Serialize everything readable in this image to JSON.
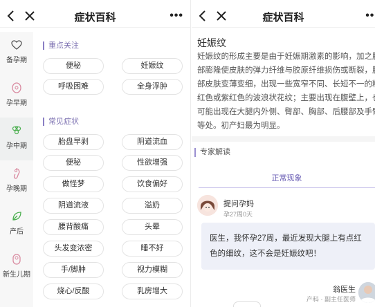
{
  "left": {
    "nav": {
      "title": "症状百科",
      "more": "•••"
    },
    "sidebar": [
      {
        "label": "备孕期",
        "icon": "heart-icon"
      },
      {
        "label": "孕早期",
        "icon": "embryo-icon"
      },
      {
        "label": "孕中期",
        "icon": "grapes-icon",
        "active": true
      },
      {
        "label": "孕晚期",
        "icon": "fetus-icon"
      },
      {
        "label": "产后",
        "icon": "leaf-icon"
      },
      {
        "label": "新生儿期",
        "icon": "baby-icon"
      }
    ],
    "focus_title": "重点关注",
    "focus_chips": [
      "便秘",
      "妊娠纹",
      "呼吸困难",
      "全身浮肿"
    ],
    "common_title": "常见症状",
    "common_chips": [
      "胎盘早剥",
      "阴道流血",
      "便秘",
      "性欲增强",
      "做怪梦",
      "饮食偏好",
      "阴道流液",
      "溢奶",
      "腰背酸痛",
      "头晕",
      "头发变浓密",
      "睡不好",
      "手/脚肿",
      "视力模糊",
      "烧心/反酸",
      "乳房增大"
    ]
  },
  "right": {
    "nav": {
      "title": "症状百科",
      "more": "•••"
    },
    "title": "妊娠纹",
    "desc": "妊娠纹的形成主要是由于妊娠期激素的影响，加之腹部膨隆使皮肤的弹力纤维与胶原纤维损伤或断裂，腹部皮肤变薄变细，出现一些宽窄不同、长短不一的粉红色或紫红色的波浪状花纹；主要出现在腹壁上，也可能出现在大腿内外侧、臀部、胸部、后腰部及手臂等处。初产妇最为明显。",
    "expert_title": "专家解读",
    "tab": "正常现象",
    "asker_name": "提问孕妈",
    "asker_sub": "孕27周0天",
    "question": "医生，我怀孕27周，最近发现大腿上有点红色的细纹，这不会是妊娠纹吧！",
    "doctor_name": "翁医生",
    "doctor_sub": "产科 · 副主任医师"
  },
  "colors": {
    "accent": "#7b6fb0",
    "active_icon": "#4caf50",
    "icon": "#d98aa0"
  }
}
